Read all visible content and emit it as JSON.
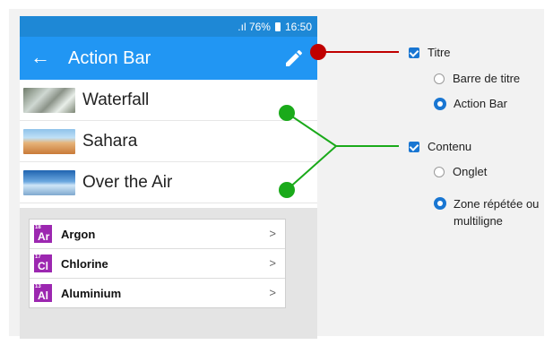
{
  "statusbar": {
    "signal_icon": "signal-icon",
    "battery_text": ".ıl 76%",
    "battery_icon": "battery-icon",
    "time": "16:50"
  },
  "actionbar": {
    "back_icon": "←",
    "title": "Action Bar",
    "edit_icon": "pencil-icon",
    "color": "#2196f3"
  },
  "list": {
    "items": [
      {
        "label": "Waterfall",
        "thumb": "waterfall-image"
      },
      {
        "label": "Sahara",
        "thumb": "sahara-image"
      },
      {
        "label": "Over the Air",
        "thumb": "over-the-air-image"
      }
    ]
  },
  "elements": {
    "items": [
      {
        "number": "18",
        "symbol": "Ar",
        "name": "Argon"
      },
      {
        "number": "17",
        "symbol": "Cl",
        "name": "Chlorine"
      },
      {
        "number": "13",
        "symbol": "Al",
        "name": "Aluminium"
      }
    ],
    "chevron": ">",
    "tile_color": "#9c27b0"
  },
  "options": {
    "titre": {
      "label": "Titre",
      "checked": true
    },
    "barre_de_titre": {
      "label": "Barre de titre",
      "selected": false
    },
    "action_bar": {
      "label": "Action Bar",
      "selected": true
    },
    "contenu": {
      "label": "Contenu",
      "checked": true
    },
    "onglet": {
      "label": "Onglet",
      "selected": false
    },
    "zone_line1": "Zone répétée ou",
    "zone_line2": "multiligne",
    "zone_selected": true
  },
  "connectors": {
    "red": "#c00000",
    "green": "#1aaa1a"
  }
}
